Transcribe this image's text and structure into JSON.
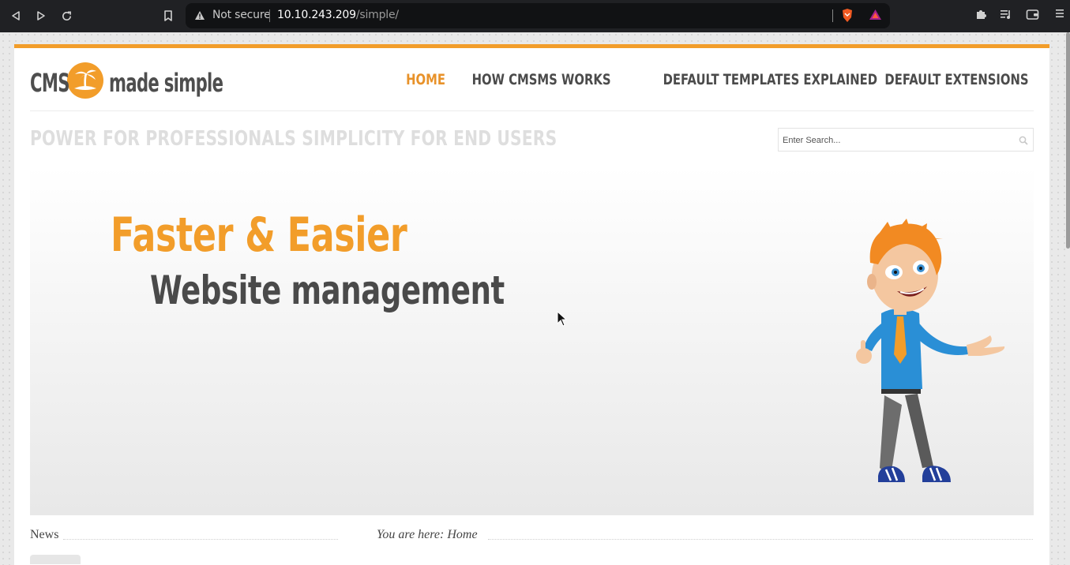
{
  "browser": {
    "security_label": "Not secure",
    "url_host": "10.10.243.209",
    "url_path": "/simple/"
  },
  "site": {
    "logo_left": "CMS",
    "logo_right": "made simple",
    "nav": [
      {
        "label": "HOME",
        "active": true
      },
      {
        "label": "HOW CMSMS WORKS"
      },
      {
        "label": "DEFAULT TEMPLATES EXPLAINED"
      },
      {
        "label": "DEFAULT EXTENSIONS"
      }
    ],
    "tagline": "POWER FOR PROFESSIONALS SIMPLICITY FOR END USERS",
    "search_placeholder": "Enter Search...",
    "banner": {
      "headline": "Faster & Easier",
      "subline": "Website management"
    },
    "news_heading": "News",
    "breadcrumb": "You are here: Home"
  },
  "colors": {
    "accent": "#f29d2a",
    "text_dark": "#4b4b4b",
    "tagline": "#dedede",
    "chrome_bg": "#202124"
  },
  "icons": [
    "back-icon",
    "forward-icon",
    "reload-icon",
    "bookmark-icon",
    "warning-icon",
    "brave-shield-icon",
    "brave-rewards-icon",
    "extensions-icon",
    "media-icon",
    "wallet-icon",
    "menu-icon",
    "search-icon"
  ]
}
